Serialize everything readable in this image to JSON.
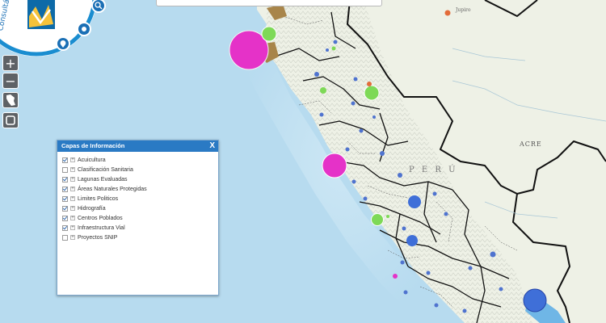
{
  "map": {
    "colors": {
      "sea": "#b7dbef",
      "land": "#eef1e6",
      "relief": "#dfe3d8",
      "border": "#111111",
      "blue": "#3f6fd8",
      "green": "#7ed957",
      "magenta": "#e532c8",
      "brown": "#a8854a"
    },
    "labels": {
      "acre": "ACRE",
      "peru_fragment": "P E R Ú",
      "top_town": "Jupiro"
    }
  },
  "controls": {
    "zoom_in": "+",
    "zoom_out": "−",
    "logo_text": "Consultá"
  },
  "layers_panel": {
    "title": "Capas de Información",
    "close_label": "X",
    "items": [
      {
        "label": "Acuicultura",
        "checked": true
      },
      {
        "label": "Clasificación Sanitaria",
        "checked": false
      },
      {
        "label": "Lagunas Evaluadas",
        "checked": true
      },
      {
        "label": "Áreas Naturales Protegidas",
        "checked": true
      },
      {
        "label": "Limites Politicos",
        "checked": true
      },
      {
        "label": "Hidrografía",
        "checked": true
      },
      {
        "label": "Centros Poblados",
        "checked": true
      },
      {
        "label": "Infraestructura Vial",
        "checked": true
      },
      {
        "label": "Proyectos SNIP",
        "checked": false
      }
    ]
  }
}
